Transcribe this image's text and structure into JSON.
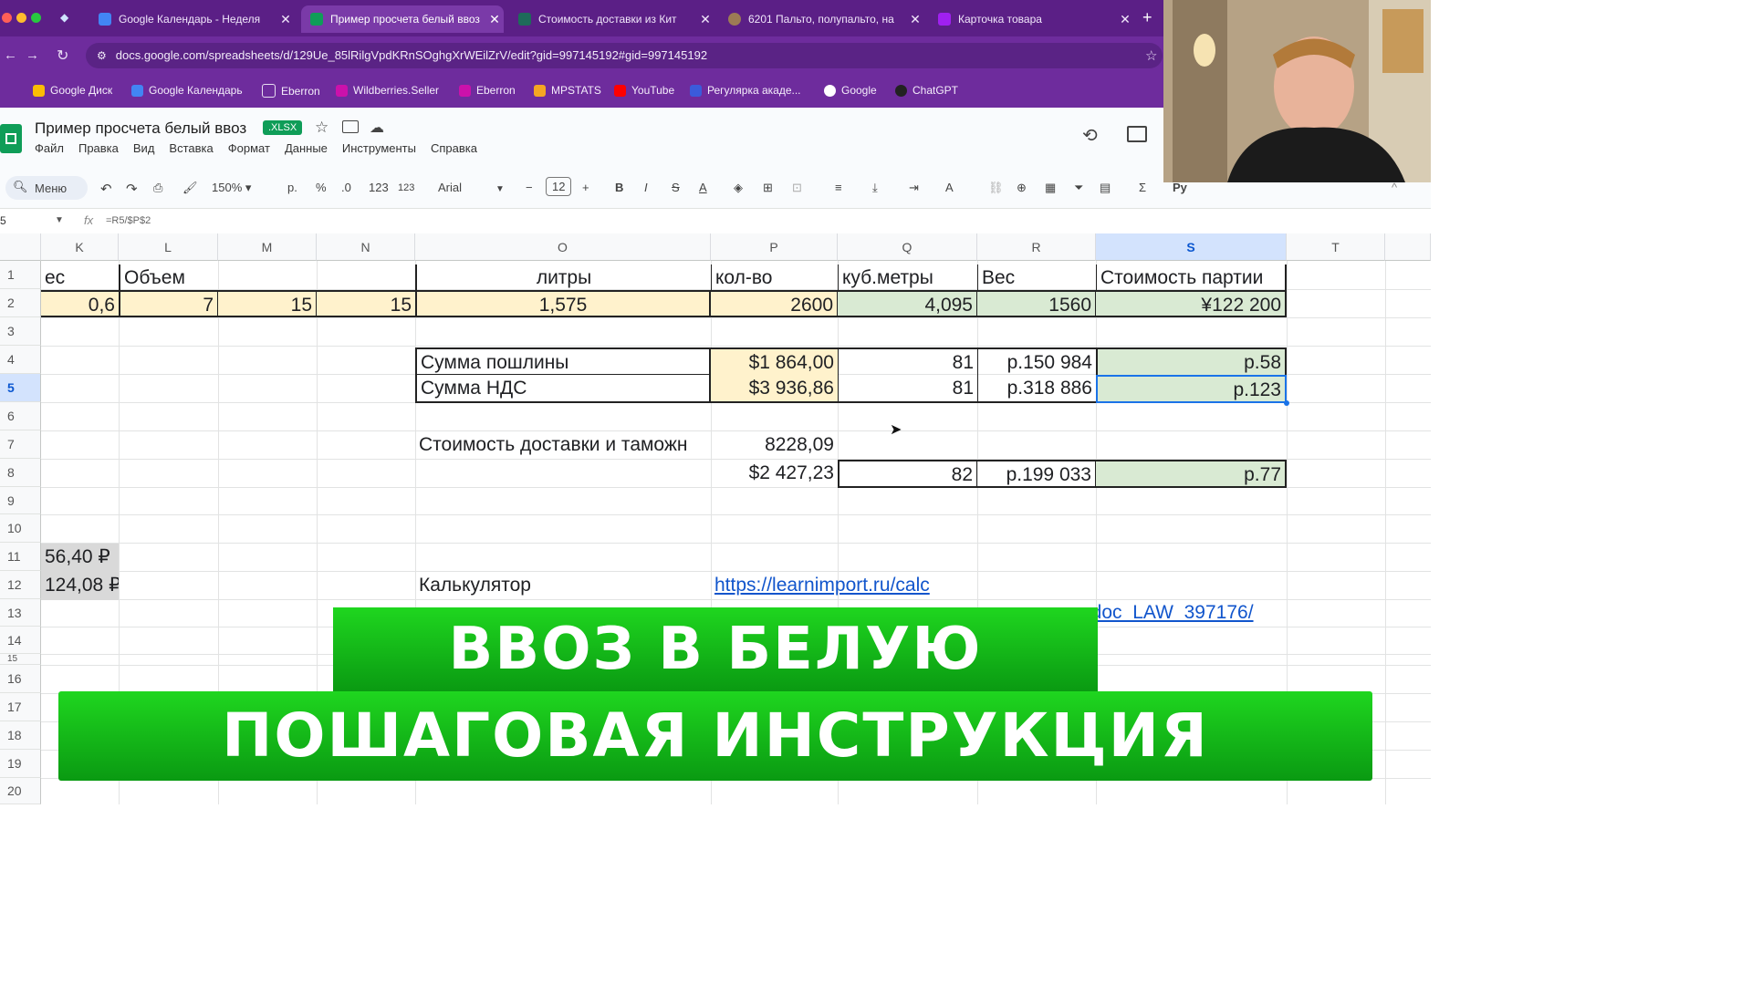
{
  "browser": {
    "tabs": [
      {
        "title": "Google Календарь - Неделя",
        "fav": "#4285f4",
        "active": false
      },
      {
        "title": "Пример просчета белый ввоз",
        "fav": "#0f9d58",
        "active": true
      },
      {
        "title": "Стоимость доставки из Кит",
        "fav": "#1e6b5a",
        "active": false
      },
      {
        "title": "6201 Пальто, полупальто, на",
        "fav": "#9c7b55",
        "active": false
      },
      {
        "title": "Карточка товара",
        "fav": "#a020f0",
        "active": false
      }
    ],
    "new_tab": "+",
    "url": "docs.google.com/spreadsheets/d/129Ue_85lRilgVpdKRnSOghgXrWEilZrV/edit?gid=997145192#gid=997145192",
    "bookmarks": [
      {
        "label": "Google Диск",
        "color": "#fbbc04"
      },
      {
        "label": "Google Календарь",
        "color": "#4285f4"
      },
      {
        "label": "Eberron",
        "color": "#e8dff1"
      },
      {
        "label": "Wildberries.Seller",
        "color": "#cb11ab"
      },
      {
        "label": "Eberron",
        "color": "#cb11ab"
      },
      {
        "label": "MPSTATS",
        "color": "#f5a623"
      },
      {
        "label": "YouTube",
        "color": "#ff0000"
      },
      {
        "label": "Регулярка акаде...",
        "color": "#3b5bdb"
      },
      {
        "label": "Google",
        "color": "#ffffff"
      },
      {
        "label": "ChatGPT",
        "color": "#222222"
      }
    ]
  },
  "doc": {
    "title": "Пример просчета белый ввоз",
    "badge": ".XLSX",
    "menu": [
      "Файл",
      "Правка",
      "Вид",
      "Вставка",
      "Формат",
      "Данные",
      "Инструменты",
      "Справка"
    ]
  },
  "toolbar": {
    "search": "Меню",
    "zoom": "150%",
    "currency": "р.",
    "percent": "%",
    "dec_minus": ".0",
    "dec_plus": ".00",
    "num": "123",
    "font": "Arial",
    "size": "12",
    "bold": "B",
    "italic": "I",
    "strike": "S",
    "textcolor": "A",
    "sum": "Σ",
    "rv": "Ру"
  },
  "formula": {
    "ref": "5",
    "fx": "fx",
    "value": "=R5/$P$2"
  },
  "columns": [
    "K",
    "L",
    "M",
    "N",
    "O",
    "P",
    "Q",
    "R",
    "S",
    "T"
  ],
  "rows": [
    "1",
    "2",
    "3",
    "4",
    "5",
    "6",
    "7",
    "8",
    "9",
    "10",
    "11",
    "12",
    "13",
    "14",
    "15",
    "16",
    "17",
    "18",
    "19",
    "20"
  ],
  "cells": {
    "K1": "ес",
    "L1": "Объем",
    "O1": "литры",
    "P1": "кол-во",
    "Q1": "куб.метры",
    "R1": "Вес",
    "S1": "Стоимость партии",
    "K2": "0,6",
    "L2": "7",
    "M2": "15",
    "N2": "15",
    "O2": "1,575",
    "P2": "2600",
    "Q2": "4,095",
    "R2": "1560",
    "S2": "¥122 200",
    "O4": "Сумма пошлины",
    "P4": "$1 864,00",
    "Q4": "81",
    "R4": "р.150 984",
    "S4": "р.58",
    "O5": "Сумма НДС",
    "P5": "$3 936,86",
    "Q5": "81",
    "R5": "р.318 886",
    "S5": "р.123",
    "O7": "Стоимость доставки и таможн",
    "P7": "8228,09",
    "P8": "$2 427,23",
    "Q8": "82",
    "R8": "р.199 033",
    "S8": "р.77",
    "K11": "56,40 ₽",
    "K12": "124,08 ₽",
    "O12": "Калькулятор",
    "P12": "https://learnimport.ru/calc",
    "P13": "_doc_LAW_397176/"
  },
  "banner": {
    "line1": "ВВОЗ В БЕЛУЮ",
    "line2": "ПОШАГОВАЯ ИНСТРУКЦИЯ"
  }
}
